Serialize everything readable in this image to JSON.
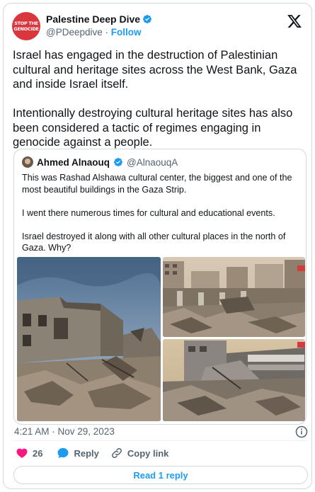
{
  "author": {
    "avatar_text": [
      "STOP THE",
      "GENOCIDE"
    ],
    "display_name": "Palestine Deep Dive",
    "handle": "@PDeepdive",
    "separator": "·",
    "follow_label": "Follow",
    "verified": true
  },
  "tweet": {
    "text": "Israel has engaged in the destruction of Palestinian cultural and heritage sites across the West Bank, Gaza and inside Israel itself.\n\nIntentionally destroying cultural heritage sites has also been considered a tactic of regimes engaging in genocide against a people."
  },
  "quoted": {
    "display_name": "Ahmed Alnaouq",
    "handle": "@AlnaouqA",
    "verified": true,
    "text": "This was Rashad Alshawa cultural center, the biggest and one of the most beautiful buildings in the Gaza Strip.\n\nI went there numerous times for cultural and educational events.\n\nIsrael destroyed it along with all other cultural places in the north of Gaza. Why?",
    "images": [
      "destroyed-building-photo",
      "rubble-street-photo",
      "collapsed-structure-photo"
    ]
  },
  "meta": {
    "timestamp": "4:21 AM · Nov 29, 2023"
  },
  "actions": {
    "like_count": "26",
    "reply_label": "Reply",
    "copy_label": "Copy link",
    "read_replies_label": "Read 1 reply"
  },
  "colors": {
    "accent": "#1d9bf0",
    "like": "#f91880",
    "avatar_bg": "#d9363e",
    "secondary_text": "#536471",
    "border": "#cfd9de"
  }
}
